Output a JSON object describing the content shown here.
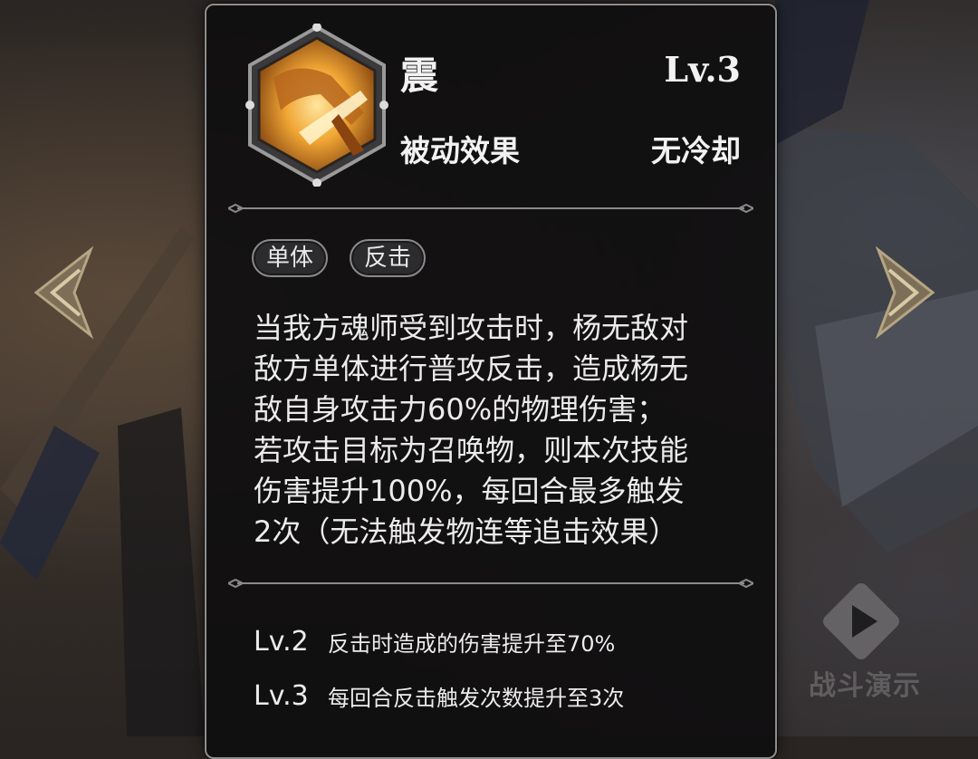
{
  "skill": {
    "name": "震",
    "level": "Lv.3",
    "type": "被动效果",
    "cooldown": "无冷却",
    "icon": "golden-spear-strike-icon"
  },
  "tags": [
    "单体",
    "反击"
  ],
  "description": "当我方魂师受到攻击时，杨无敌对\n敌方单体进行普攻反击，造成杨无\n敌自身攻击力60%的物理伤害；\n若攻击目标为召唤物，则本次技能\n伤害提升100%，每回合最多触发\n2次（无法触发物连等追击效果）",
  "levels": [
    {
      "name": "Lv.2",
      "text": "反击时造成的伤害提升至70%"
    },
    {
      "name": "Lv.3",
      "text": "每回合反击触发次数提升至3次"
    }
  ],
  "battle_demo": {
    "label": "战斗演示",
    "icon": "play-icon"
  },
  "nav": {
    "prev_icon": "chevron-left-icon",
    "next_icon": "chevron-right-icon"
  },
  "colors": {
    "panel_bg": "#100f10",
    "panel_border": "#8e8e8e",
    "text": "#f2f2f2",
    "icon_gold": "#e8a23a"
  }
}
